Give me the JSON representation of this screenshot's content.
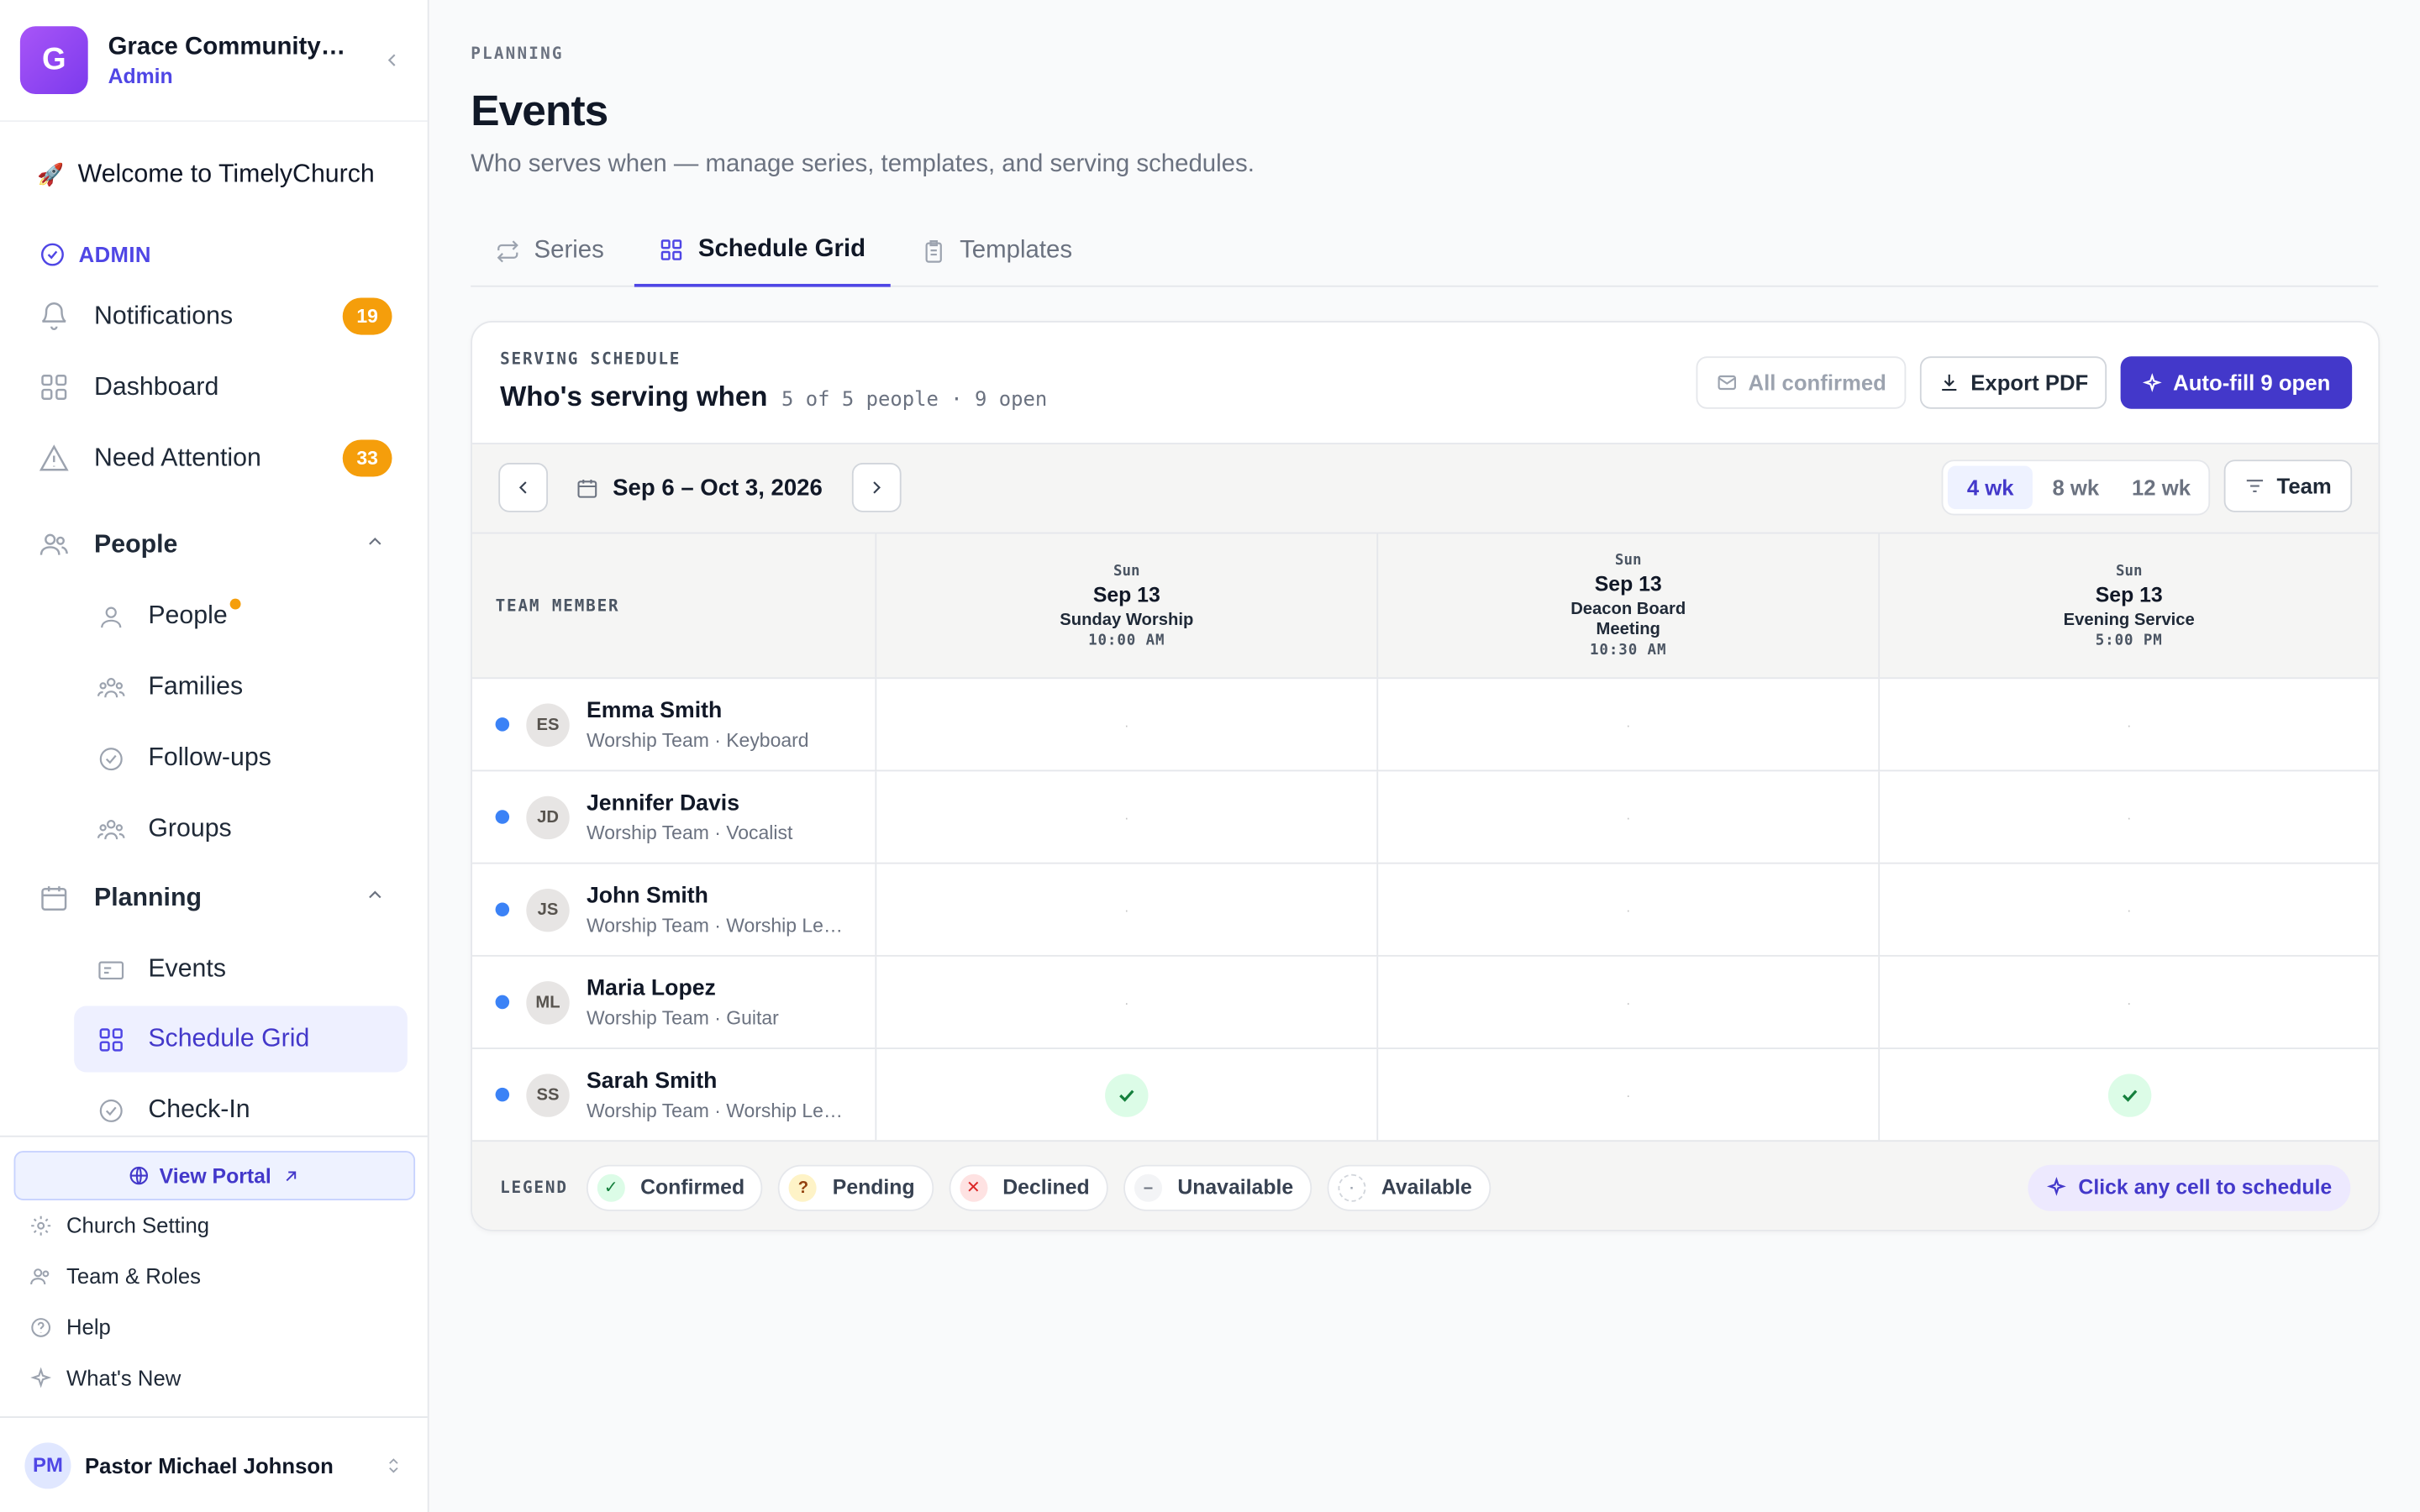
{
  "org": {
    "logo_letter": "G",
    "name": "Grace Community Church",
    "role": "Admin"
  },
  "welcome": {
    "emoji": "🚀",
    "label": "Welcome to TimelyChurch"
  },
  "admin_label": "ADMIN",
  "nav": {
    "notifications": {
      "label": "Notifications",
      "badge": "19"
    },
    "dashboard": {
      "label": "Dashboard"
    },
    "need_attention": {
      "label": "Need Attention",
      "badge": "33"
    },
    "people_section": "People",
    "people_items": [
      "People",
      "Families",
      "Follow-ups",
      "Groups"
    ],
    "planning_section": "Planning",
    "planning_items": [
      "Events",
      "Schedule Grid",
      "Check-In"
    ]
  },
  "footer": {
    "view_portal": "View Portal",
    "links": [
      "Church Setting",
      "Team & Roles",
      "Help",
      "What's New"
    ],
    "user_initials": "PM",
    "user_name": "Pastor Michael Johnson"
  },
  "page": {
    "eyebrow": "PLANNING",
    "title": "Events",
    "subtitle": "Who serves when — manage series, templates, and serving schedules.",
    "tabs": [
      "Series",
      "Schedule Grid",
      "Templates"
    ]
  },
  "schedule": {
    "eyebrow": "SERVING SCHEDULE",
    "title": "Who's serving when",
    "meta": "5 of 5 people · 9 open",
    "btn_all_confirmed": "All confirmed",
    "btn_export": "Export PDF",
    "btn_autofill": "Auto-fill 9 open",
    "date_range": "Sep 6 – Oct 3, 2026",
    "ranges": [
      "4 wk",
      "8 wk",
      "12 wk"
    ],
    "team_filter": "Team",
    "member_header": "TEAM MEMBER",
    "columns": [
      {
        "dow": "Sun",
        "date": "Sep 13",
        "name": "Sunday Worship",
        "time": "10:00 AM"
      },
      {
        "dow": "Sun",
        "date": "Sep 13",
        "name": "Deacon Board Meeting",
        "time": "10:30 AM"
      },
      {
        "dow": "Sun",
        "date": "Sep 13",
        "name": "Evening Service",
        "time": "5:00 PM"
      }
    ],
    "empty_marker": "·",
    "rows": [
      {
        "initials": "ES",
        "name": "Emma Smith",
        "role": "Worship Team · Keyboard",
        "cells": [
          "",
          "",
          ""
        ]
      },
      {
        "initials": "JD",
        "name": "Jennifer Davis",
        "role": "Worship Team · Vocalist",
        "cells": [
          "",
          "",
          ""
        ]
      },
      {
        "initials": "JS",
        "name": "John Smith",
        "role": "Worship Team · Worship Leader",
        "cells": [
          "",
          "",
          ""
        ]
      },
      {
        "initials": "ML",
        "name": "Maria Lopez",
        "role": "Worship Team · Guitar",
        "cells": [
          "",
          "",
          ""
        ]
      },
      {
        "initials": "SS",
        "name": "Sarah Smith",
        "role": "Worship Team · Worship Leader",
        "cells": [
          "confirmed",
          "",
          "confirmed"
        ]
      }
    ],
    "legend_title": "LEGEND",
    "legend": [
      {
        "key": "confirmed",
        "label": "Confirmed",
        "symbol": "✓"
      },
      {
        "key": "pending",
        "label": "Pending",
        "symbol": "?"
      },
      {
        "key": "declined",
        "label": "Declined",
        "symbol": "✕"
      },
      {
        "key": "unavailable",
        "label": "Unavailable",
        "symbol": "–"
      },
      {
        "key": "available",
        "label": "Available",
        "symbol": "·"
      }
    ],
    "hint": "Click any cell to schedule"
  },
  "colors": {
    "accent": "#4338ca",
    "badge": "#f59e0b",
    "confirmed_bg": "#dcfce7",
    "member_dot": "#3b82f6"
  }
}
